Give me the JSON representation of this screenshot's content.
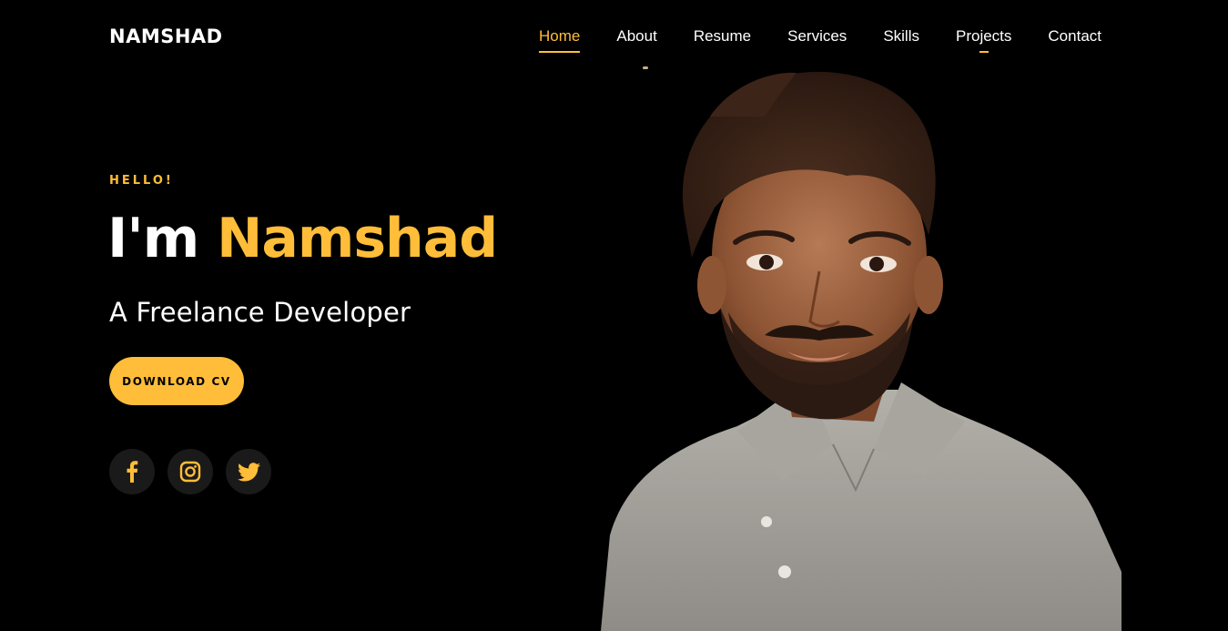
{
  "header": {
    "brand": "NAMSHAD",
    "nav": [
      {
        "label": "Home",
        "active": true
      },
      {
        "label": "About",
        "active": false
      },
      {
        "label": "Resume",
        "active": false
      },
      {
        "label": "Services",
        "active": false
      },
      {
        "label": "Skills",
        "active": false
      },
      {
        "label": "Projects",
        "active": false
      },
      {
        "label": "Contact",
        "active": false
      }
    ]
  },
  "hero": {
    "greeting": "HELLO!",
    "intro": "I'm",
    "name": "Namshad",
    "subtitle": "A Freelance Developer",
    "cta_label": "DOWNLOAD CV",
    "socials": [
      {
        "icon": "facebook-icon"
      },
      {
        "icon": "instagram-icon"
      },
      {
        "icon": "twitter-icon"
      }
    ]
  },
  "theme": {
    "accent": "#ffbd39",
    "background": "#000000",
    "social_bg": "#1a1a1a"
  }
}
